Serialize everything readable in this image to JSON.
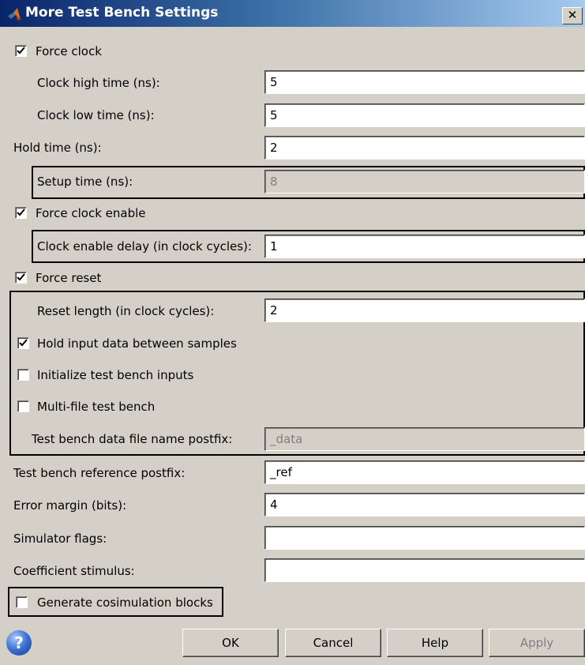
{
  "window": {
    "title": "More Test Bench Settings",
    "close_glyph": "✕"
  },
  "icons": {
    "title": "matlab-logo-icon",
    "close": "close-icon",
    "help": "help-icon",
    "check": "check-icon"
  },
  "form": {
    "force_clock": {
      "label": "Force clock",
      "checked": true
    },
    "clock_high_time": {
      "label": "Clock high time (ns):",
      "value": "5"
    },
    "clock_low_time": {
      "label": "Clock low time (ns):",
      "value": "5"
    },
    "hold_time": {
      "label": "Hold time (ns):",
      "value": "2"
    },
    "setup_time": {
      "label": "Setup time (ns):",
      "value": "8",
      "enabled": false
    },
    "force_clock_enable": {
      "label": "Force clock enable",
      "checked": true
    },
    "clock_enable_delay": {
      "label": "Clock enable delay (in clock cycles):",
      "value": "1"
    },
    "force_reset": {
      "label": "Force reset",
      "checked": true
    },
    "reset_length": {
      "label": "Reset length (in clock cycles):",
      "value": "2"
    },
    "hold_input_data": {
      "label": "Hold input data between samples",
      "checked": true
    },
    "initialize_inputs": {
      "label": "Initialize test bench inputs",
      "checked": false
    },
    "multi_file": {
      "label": "Multi-file test bench",
      "checked": false
    },
    "data_file_postfix": {
      "label": "Test bench data file name postfix:",
      "value": "_data",
      "enabled": false
    },
    "reference_postfix": {
      "label": "Test bench reference postfix:",
      "value": "_ref"
    },
    "error_margin": {
      "label": "Error margin (bits):",
      "value": "4"
    },
    "simulator_flags": {
      "label": "Simulator flags:",
      "value": ""
    },
    "coefficient_stimulus": {
      "label": "Coefficient stimulus:",
      "value": ""
    },
    "generate_cosim": {
      "label": "Generate cosimulation blocks",
      "checked": false
    }
  },
  "buttons": {
    "help_glyph": "?",
    "ok": "OK",
    "cancel": "Cancel",
    "help": "Help",
    "apply": {
      "label": "Apply",
      "enabled": false
    }
  },
  "colors": {
    "dialog_bg": "#d4d0c8",
    "title_gradient_start": "#0a246a",
    "title_gradient_end": "#a6caf0",
    "highlight_box": "#000000"
  }
}
